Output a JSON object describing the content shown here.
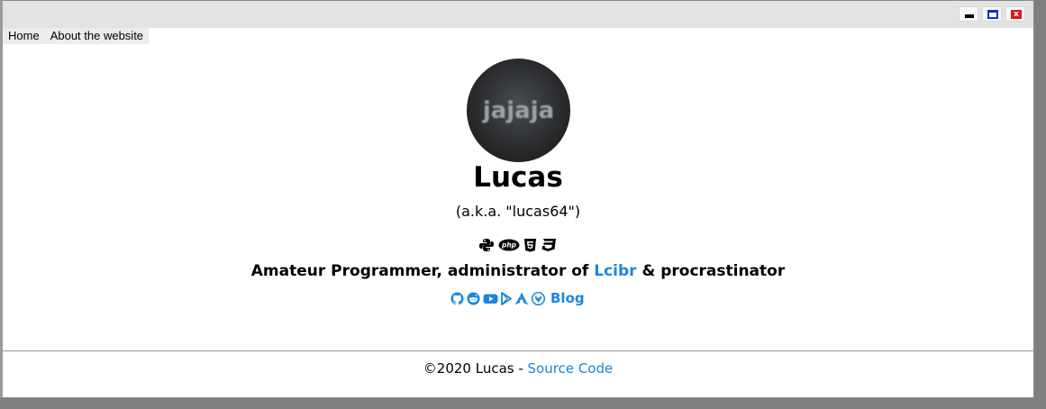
{
  "window": {
    "minimize_icon": "minimize-icon",
    "maximize_icon": "maximize-icon",
    "close_icon": "close-icon",
    "close_glyph": "x"
  },
  "menu": {
    "items": [
      {
        "label": "Home"
      },
      {
        "label": "About the website"
      }
    ]
  },
  "profile": {
    "avatar_text": "jajaja",
    "name": "Lucas",
    "aka": "(a.k.a. \"lucas64\")",
    "languages": [
      "python-icon",
      "php-icon",
      "html5-icon",
      "css3-icon"
    ],
    "php_icon_text": "php",
    "tagline_prefix": "Amateur Programmer, administrator of ",
    "tagline_link": "Lcibr",
    "tagline_suffix": " & procrastinator",
    "socials": [
      "github-icon",
      "reddit-icon",
      "youtube-icon",
      "play-store-icon",
      "arch-linux-icon",
      "gitlab-icon"
    ],
    "blog_label": "Blog"
  },
  "footer": {
    "copyright": "©2020 Lucas - ",
    "source_link": "Source Code"
  },
  "colors": {
    "link": "#1a86e0",
    "background": "#ffffff",
    "titlebar": "#e3e3e3"
  }
}
